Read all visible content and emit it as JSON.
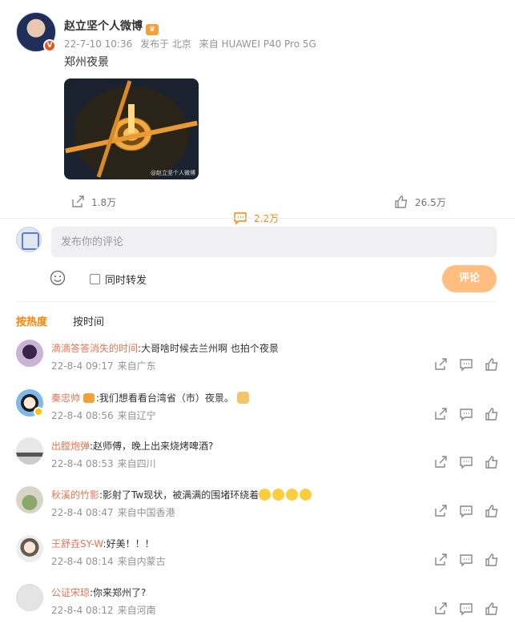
{
  "post": {
    "author": "赵立坚个人微博",
    "date": "22-7-10 10:36",
    "location": "发布于 北京",
    "source": "来自 HUAWEI P40 Pro 5G",
    "text": "郑州夜景",
    "image_watermark": "@赵立坚个人微博"
  },
  "actions": {
    "repost_count": "1.8万",
    "comment_count": "2.2万",
    "like_count": "26.5万",
    "comment_color": "#ff8200"
  },
  "composer": {
    "placeholder": "发布你的评论",
    "repost_label": "同时转发",
    "submit_label": "评论",
    "submit_color": "#ffbe7f"
  },
  "sort_tabs": {
    "hot": "按热度",
    "time": "按时间"
  },
  "comments": [
    {
      "name": "滴滴答答消失的时间",
      "text": ":大哥啥时候去兰州啊 也拍个夜景",
      "date": "22-8-4 09:17",
      "from": "来自广东"
    },
    {
      "name": "秦忠帅",
      "text": ":我们想看看台湾省（市）夜景。",
      "date": "22-8-4 08:56",
      "from": "来自辽宁"
    },
    {
      "name": "出膛炮弹",
      "text": ":赵师傅，晚上出来烧烤啤酒?",
      "date": "22-8-4 08:53",
      "from": "来自四川"
    },
    {
      "name": "秋溪的竹影",
      "text": ":影射了Tw现状，被满满的围堵环绕着",
      "date": "22-8-4 08:47",
      "from": "来自中国香港"
    },
    {
      "name": "王舒垚SY-W",
      "text": ":好美！！！",
      "date": "22-8-4 08:14",
      "from": "来自内蒙古"
    },
    {
      "name": "公证宋琼",
      "text": ":你来郑州了?",
      "date": "22-8-4 08:12",
      "from": "来自河南"
    }
  ]
}
